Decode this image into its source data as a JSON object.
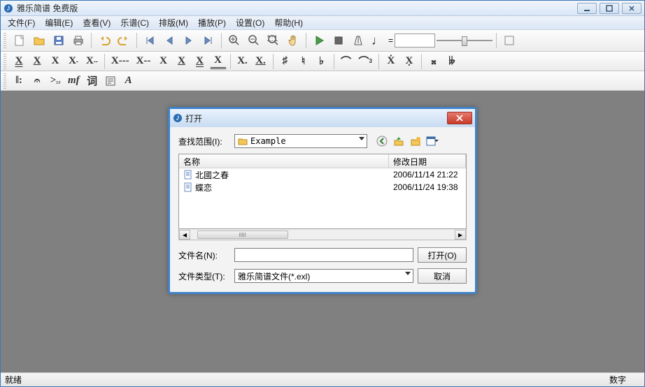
{
  "title": "雅乐简谱 免费版",
  "menus": [
    "文件(F)",
    "编辑(E)",
    "查看(V)",
    "乐谱(C)",
    "排版(M)",
    "播放(P)",
    "设置(O)",
    "帮助(H)"
  ],
  "toolbar1_names": [
    "new",
    "open",
    "save",
    "print",
    "undo",
    "redo",
    "first",
    "prev",
    "next",
    "last",
    "zoom-in",
    "zoom-out",
    "zoom-fit",
    "hand",
    "play",
    "stop",
    "metronome"
  ],
  "status_left": "就绪",
  "status_right": "数字",
  "dialog": {
    "title": "打开",
    "lookin_label": "查找范围(I):",
    "lookin_value": "Example",
    "col_name": "名称",
    "col_date": "修改日期",
    "rows": [
      {
        "name": "北國之春",
        "date": "2006/11/14 21:22"
      },
      {
        "name": "蝶恋",
        "date": "2006/11/24 19:38"
      }
    ],
    "filename_label": "文件名(N):",
    "filename_value": "",
    "filetype_label": "文件类型(T):",
    "filetype_value": "雅乐简谱文件(*.exl)",
    "open_btn": "打开(O)",
    "cancel_btn": "取消"
  }
}
